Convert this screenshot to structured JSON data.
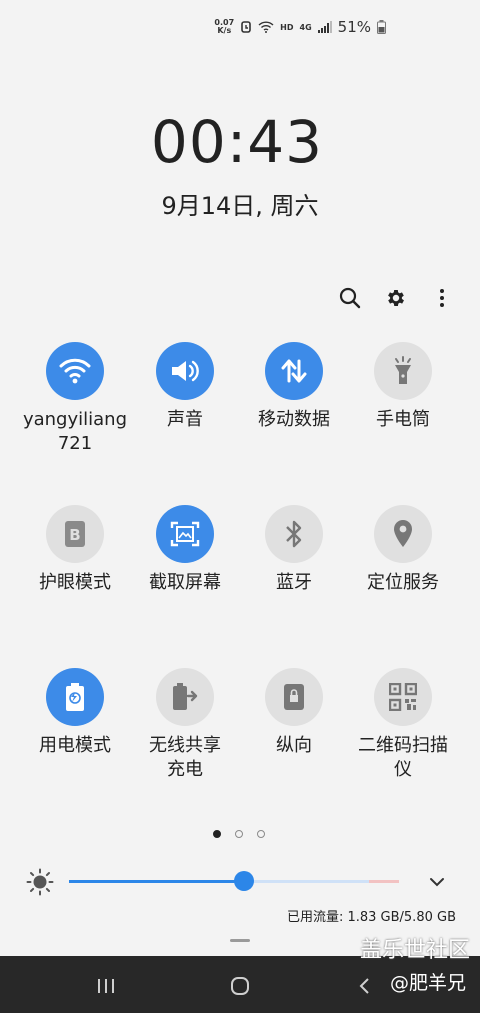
{
  "status_bar": {
    "net_speed_value": "0.07",
    "net_speed_unit": "K/s",
    "hd": "HD",
    "network": "4G",
    "battery_percent": "51%"
  },
  "clock": {
    "time": "00:43",
    "date": "9月14日, 周六"
  },
  "toolbar": {
    "search_icon": "search-icon",
    "settings_icon": "gear-icon",
    "more_icon": "more-vert-icon"
  },
  "tiles": [
    {
      "label": "yangyiliang\n721",
      "icon": "wifi-icon",
      "on": true
    },
    {
      "label": "声音",
      "icon": "volume-icon",
      "on": true
    },
    {
      "label": "移动数据",
      "icon": "data-arrows-icon",
      "on": true
    },
    {
      "label": "手电筒",
      "icon": "flashlight-icon",
      "on": false
    },
    {
      "label": "护眼模式",
      "icon": "eye-comfort-icon",
      "on": false
    },
    {
      "label": "截取屏幕",
      "icon": "screenshot-icon",
      "on": true
    },
    {
      "label": "蓝牙",
      "icon": "bluetooth-icon",
      "on": false
    },
    {
      "label": "定位服务",
      "icon": "location-icon",
      "on": false
    },
    {
      "label": "用电模式",
      "icon": "power-mode-icon",
      "on": true
    },
    {
      "label": "无线共享\n充电",
      "icon": "wireless-share-icon",
      "on": false
    },
    {
      "label": "纵向",
      "icon": "portrait-lock-icon",
      "on": false
    },
    {
      "label": "二维码扫描\n仪",
      "icon": "qr-code-icon",
      "on": false
    }
  ],
  "pager": {
    "page_count": 3,
    "active_page": 1
  },
  "brightness": {
    "level": 0.53
  },
  "data_usage": "已用流量: 1.83 GB/5.80 GB",
  "navigation": {
    "recents": "recents-icon",
    "home": "home-icon",
    "back": "back-icon"
  },
  "watermark": {
    "site": "盖乐世社区",
    "credit": "@肥羊兄"
  }
}
